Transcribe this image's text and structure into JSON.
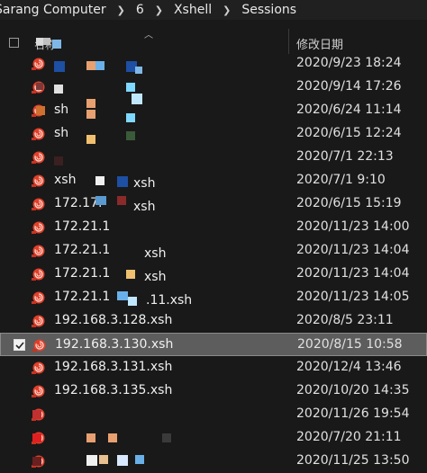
{
  "breadcrumb": [
    "Sarang Computer",
    "6",
    "Xshell",
    "Sessions"
  ],
  "header": {
    "name": "名称",
    "date_modified": "修改日期"
  },
  "rows": [
    {
      "name": "",
      "date": "2020/9/23 18:24"
    },
    {
      "name": "",
      "date": "2020/9/14 17:26"
    },
    {
      "name": "sh",
      "date": "2020/6/24 11:14"
    },
    {
      "name": "sh",
      "date": "2020/6/15 12:24"
    },
    {
      "name": "",
      "date": "2020/7/1 22:13"
    },
    {
      "name": "xsh",
      "date": "2020/7/1 9:10"
    },
    {
      "name": "172.17.",
      "date": "2020/6/15 15:19"
    },
    {
      "name": "172.21.1",
      "date": "2020/11/23 14:00"
    },
    {
      "name": "172.21.1",
      "date": "2020/11/23 14:04"
    },
    {
      "name": "172.21.1",
      "date": "2020/11/23 14:04"
    },
    {
      "name": "172.21.1",
      "date": "2020/11/23 14:05"
    },
    {
      "name": "192.168.3.128.xsh",
      "date": "2020/8/5 23:11"
    },
    {
      "name": "192.168.3.130.xsh",
      "date": "2020/8/15 10:58",
      "selected": true
    },
    {
      "name": "192.168.3.131.xsh",
      "date": "2020/12/4 13:46"
    },
    {
      "name": "192.168.3.135.xsh",
      "date": "2020/10/20 14:35"
    },
    {
      "name": "",
      "date": "2020/11/26 19:54"
    },
    {
      "name": "",
      "date": "2020/7/20 21:11"
    },
    {
      "name": "",
      "date": "2020/11/25 13:50"
    }
  ],
  "row_suffixes": [
    "xsh",
    "xsh",
    "xsh",
    "xsh",
    ".11.xsh"
  ],
  "colors": {
    "background": "#191919",
    "selected": "#5d5d5d",
    "icon": "#e0402a"
  }
}
